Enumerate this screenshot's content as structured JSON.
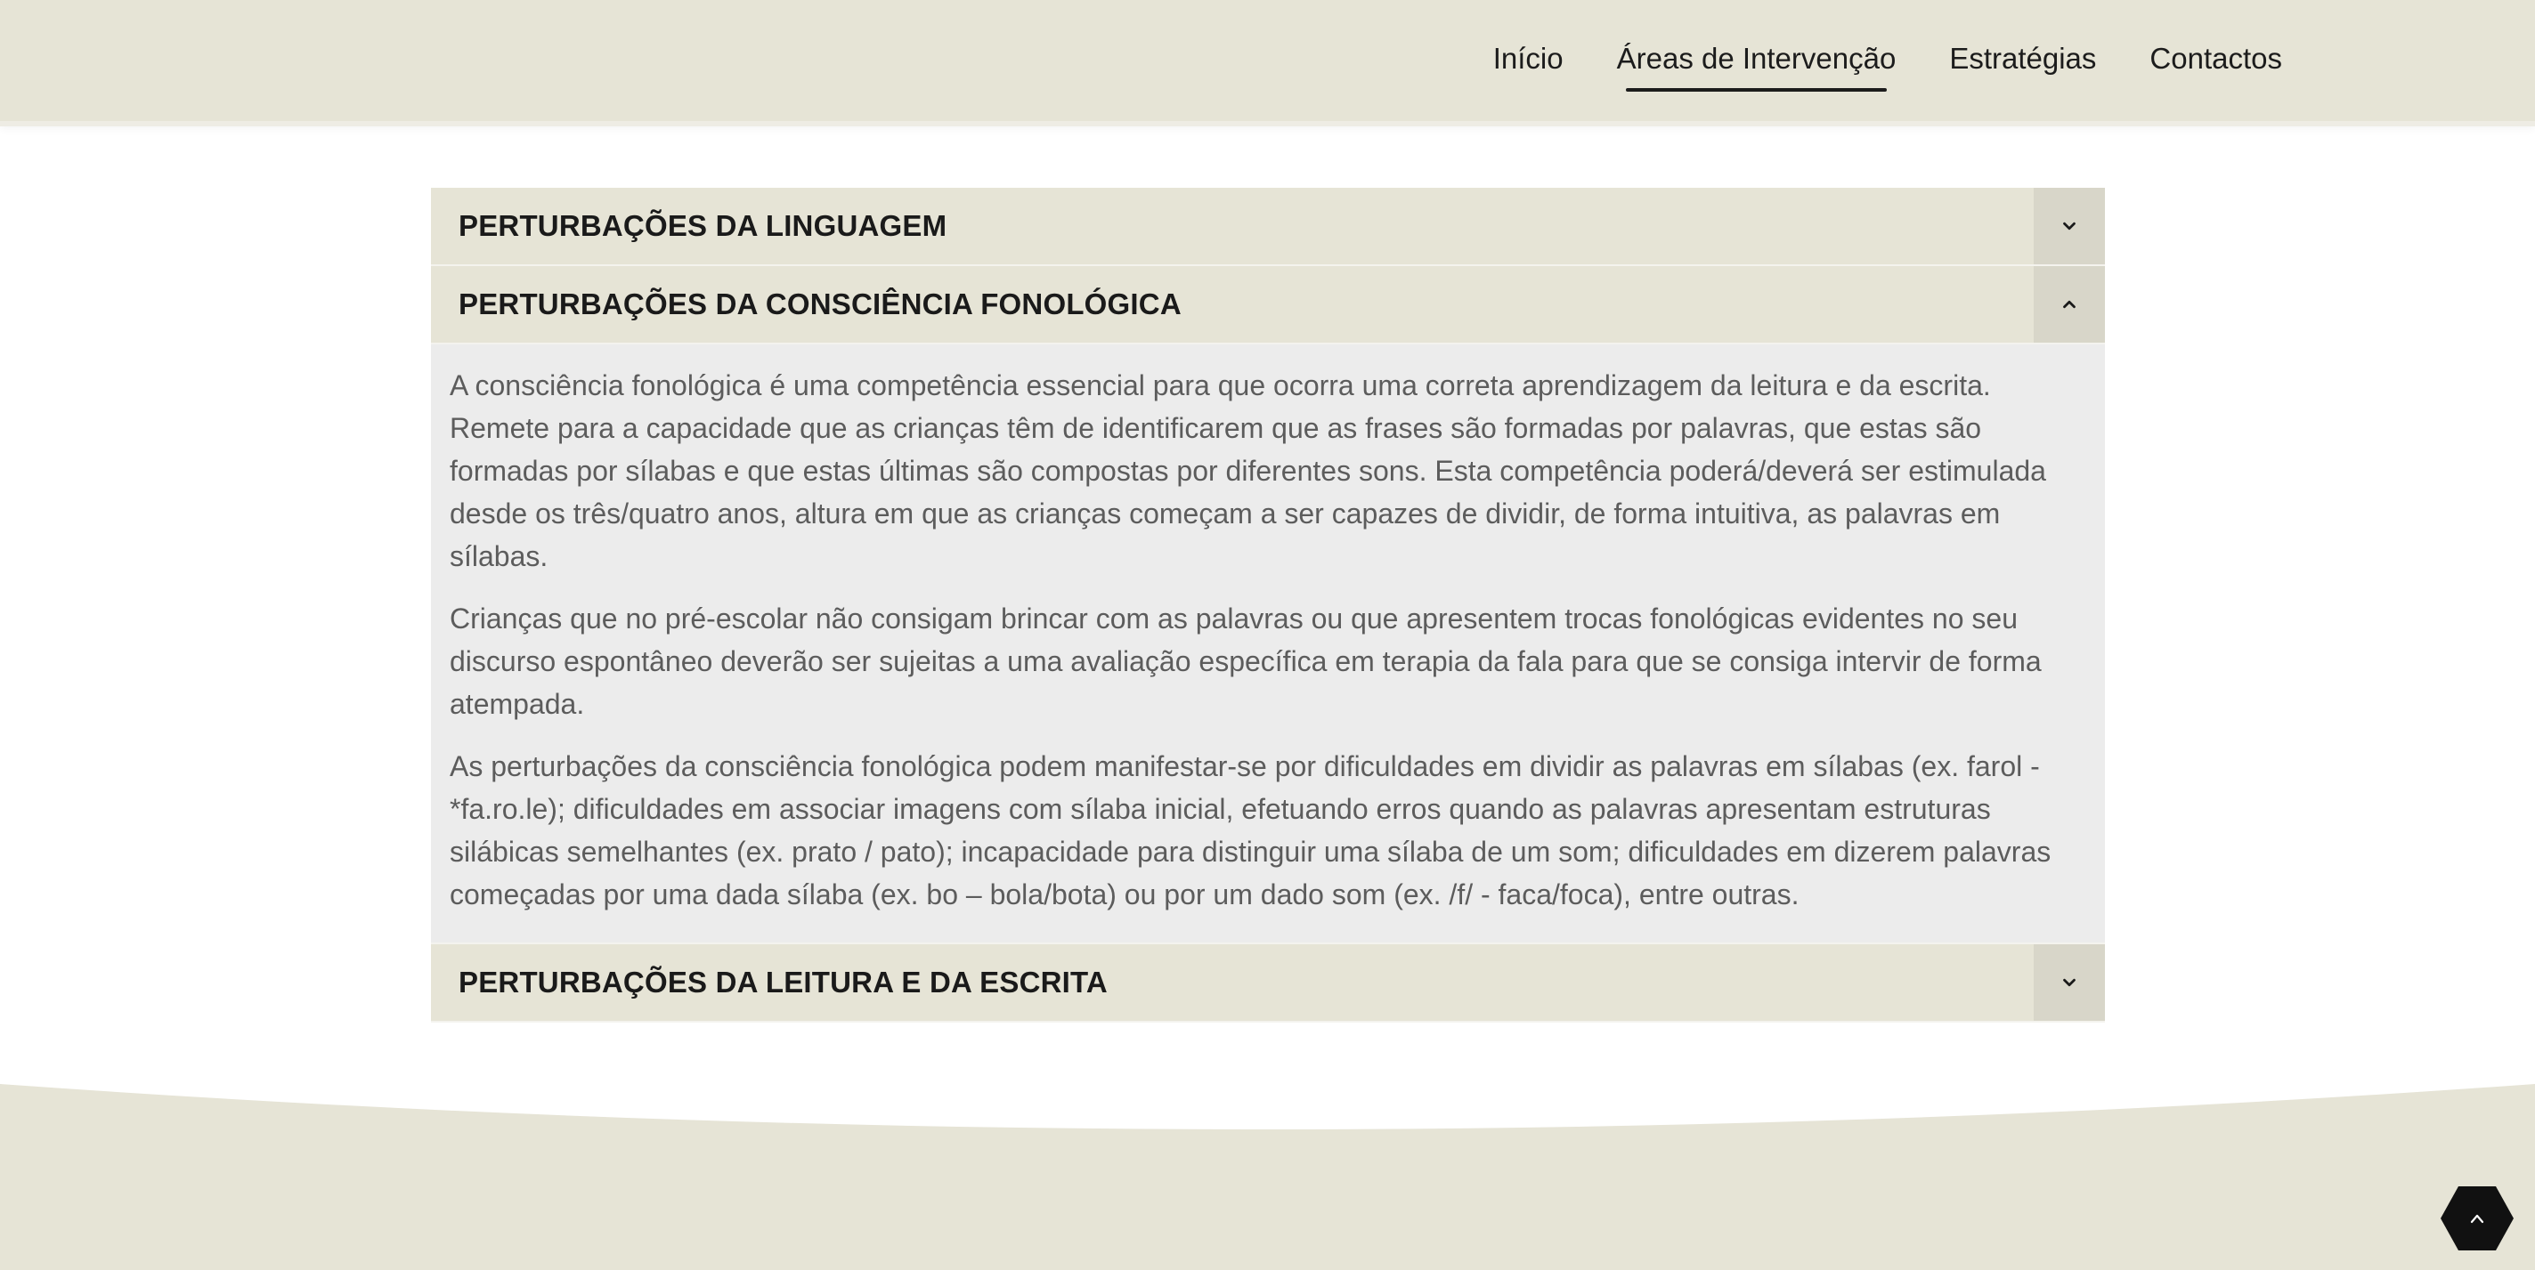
{
  "nav": {
    "items": [
      {
        "label": "Início",
        "active": false
      },
      {
        "label": "Áreas de Intervenção",
        "active": true
      },
      {
        "label": "Estratégias",
        "active": false
      },
      {
        "label": "Contactos",
        "active": false
      }
    ]
  },
  "accordion": {
    "sections": [
      {
        "title": "PERTURBAÇÕES DA LINGUAGEM",
        "expanded": false,
        "toggle_icon": "chevron-down-icon"
      },
      {
        "title": "PERTURBAÇÕES DA CONSCIÊNCIA FONOLÓGICA",
        "expanded": true,
        "toggle_icon": "chevron-up-icon",
        "paragraphs": [
          "A consciência fonológica é uma competência essencial para que ocorra uma correta aprendizagem da leitura e da escrita. Remete para a capacidade que as crianças têm de identificarem que as frases são formadas por palavras, que estas são formadas por sílabas e que estas últimas são compostas por diferentes sons. Esta competência poderá/deverá ser estimulada desde os três/quatro anos, altura em que as crianças começam a ser capazes de dividir, de forma intuitiva, as palavras em sílabas.",
          "Crianças que no pré-escolar não consigam brincar com as palavras ou que apresentem trocas fonológicas evidentes no seu discurso espontâneo deverão ser sujeitas a uma avaliação específica em terapia da fala para que se consiga intervir de forma atempada.",
          "As perturbações da consciência fonológica podem manifestar-se por dificuldades em dividir as palavras em sílabas (ex. farol - *fa.ro.le); dificuldades em associar imagens com sílaba inicial, efetuando erros quando as palavras apresentam estruturas silábicas semelhantes (ex. prato / pato); incapacidade para distinguir uma sílaba de um som; dificuldades em dizerem palavras começadas por uma dada sílaba (ex. bo – bola/bota) ou por um dado som (ex. /f/ - faca/foca), entre outras."
        ]
      },
      {
        "title": "PERTURBAÇÕES DA LEITURA E DA ESCRITA",
        "expanded": false,
        "toggle_icon": "chevron-down-icon"
      }
    ]
  },
  "back_to_top": {
    "icon": "chevron-up-icon"
  },
  "colors": {
    "header_bg": "#e6e4d6",
    "panel_body_bg": "#ececec",
    "toggle_bg": "#d8d6c9",
    "text_dark": "#1a1a1a",
    "text_body": "#5c5c5c",
    "back_top_bg": "#111111"
  }
}
